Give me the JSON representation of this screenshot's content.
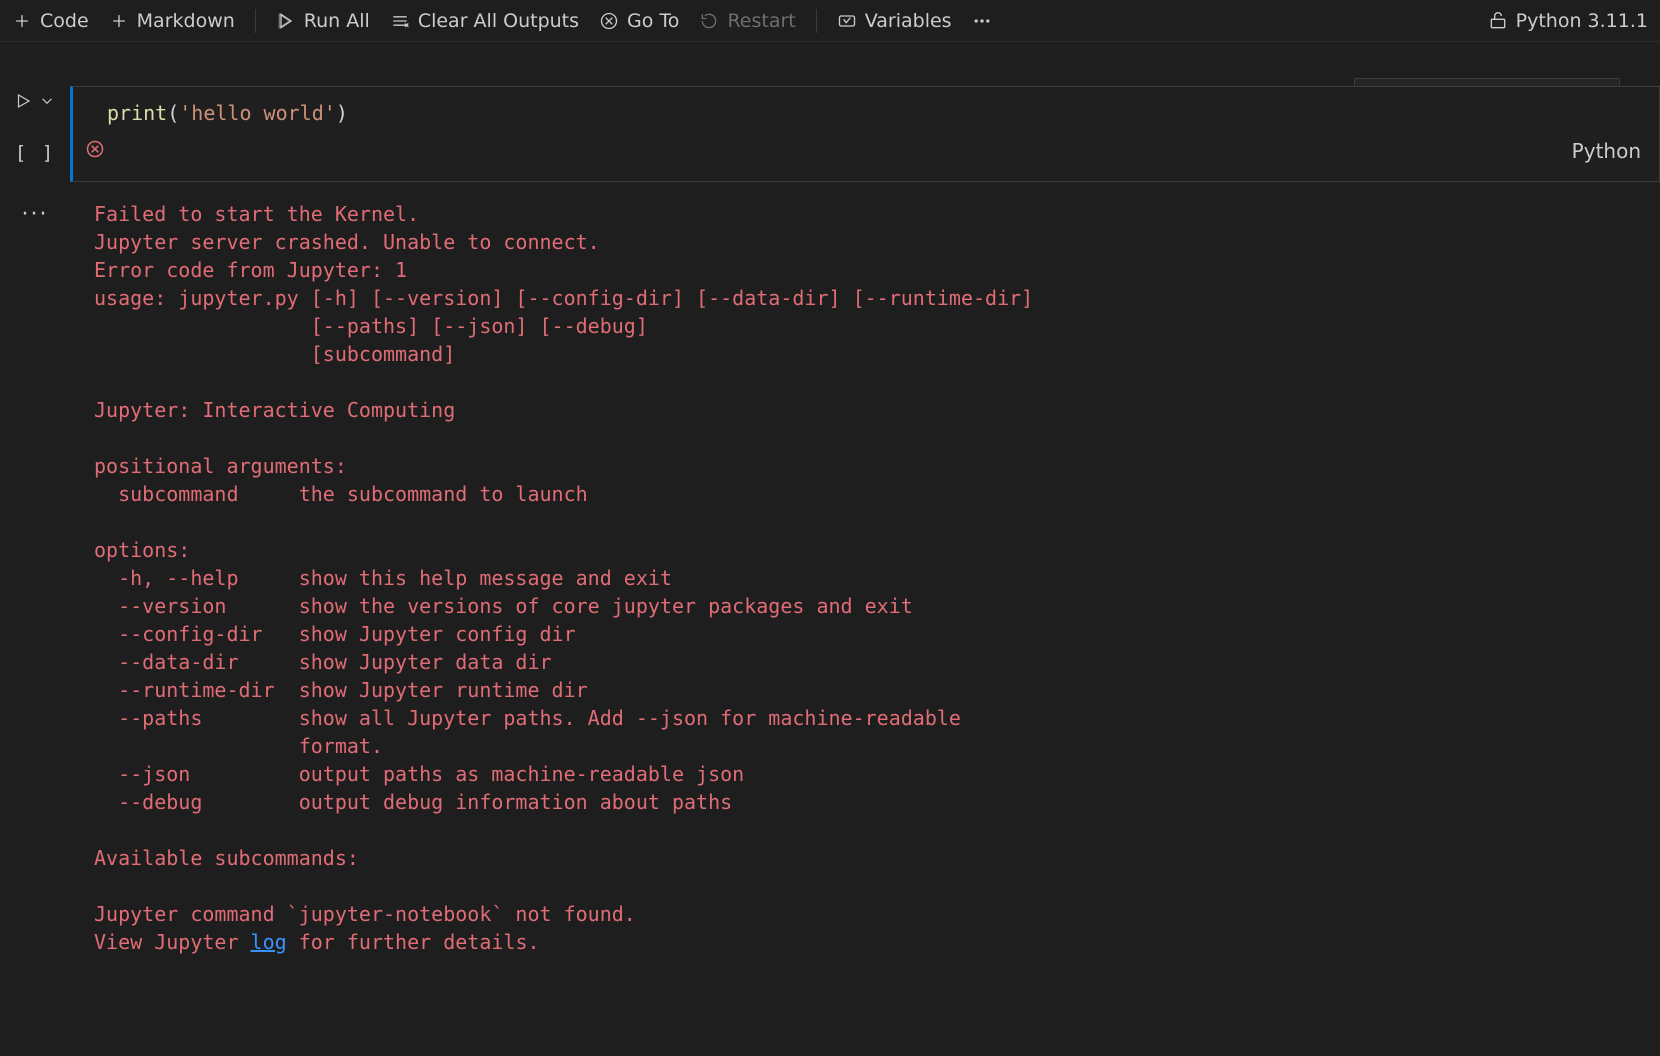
{
  "toolbar": {
    "code": "Code",
    "markdown": "Markdown",
    "runAll": "Run All",
    "clearAll": "Clear All Outputs",
    "goto": "Go To",
    "restart": "Restart",
    "variables": "Variables",
    "kernel": "Python 3.11.1"
  },
  "cell": {
    "execLabel": "[ ]",
    "langLabel": "Python",
    "code": {
      "fn": "print",
      "lp": "(",
      "str": "'hello world'",
      "rp": ")"
    }
  },
  "output": {
    "lines": [
      "Failed to start the Kernel. ",
      "Jupyter server crashed. Unable to connect. ",
      "Error code from Jupyter: 1",
      "usage: jupyter.py [-h] [--version] [--config-dir] [--data-dir] [--runtime-dir]",
      "                  [--paths] [--json] [--debug]",
      "                  [subcommand]",
      "",
      "Jupyter: Interactive Computing",
      "",
      "positional arguments:",
      "  subcommand     the subcommand to launch",
      "",
      "options:",
      "  -h, --help     show this help message and exit",
      "  --version      show the versions of core jupyter packages and exit",
      "  --config-dir   show Jupyter config dir",
      "  --data-dir     show Jupyter data dir",
      "  --runtime-dir  show Jupyter runtime dir",
      "  --paths        show all Jupyter paths. Add --json for machine-readable",
      "                 format.",
      "  --json         output paths as machine-readable json",
      "  --debug        output debug information about paths",
      "",
      "Available subcommands:",
      "",
      "Jupyter command `jupyter-notebook` not found. "
    ],
    "lastPrefix": "View Jupyter ",
    "lastLink": "log",
    "lastSuffix": " for further details."
  }
}
